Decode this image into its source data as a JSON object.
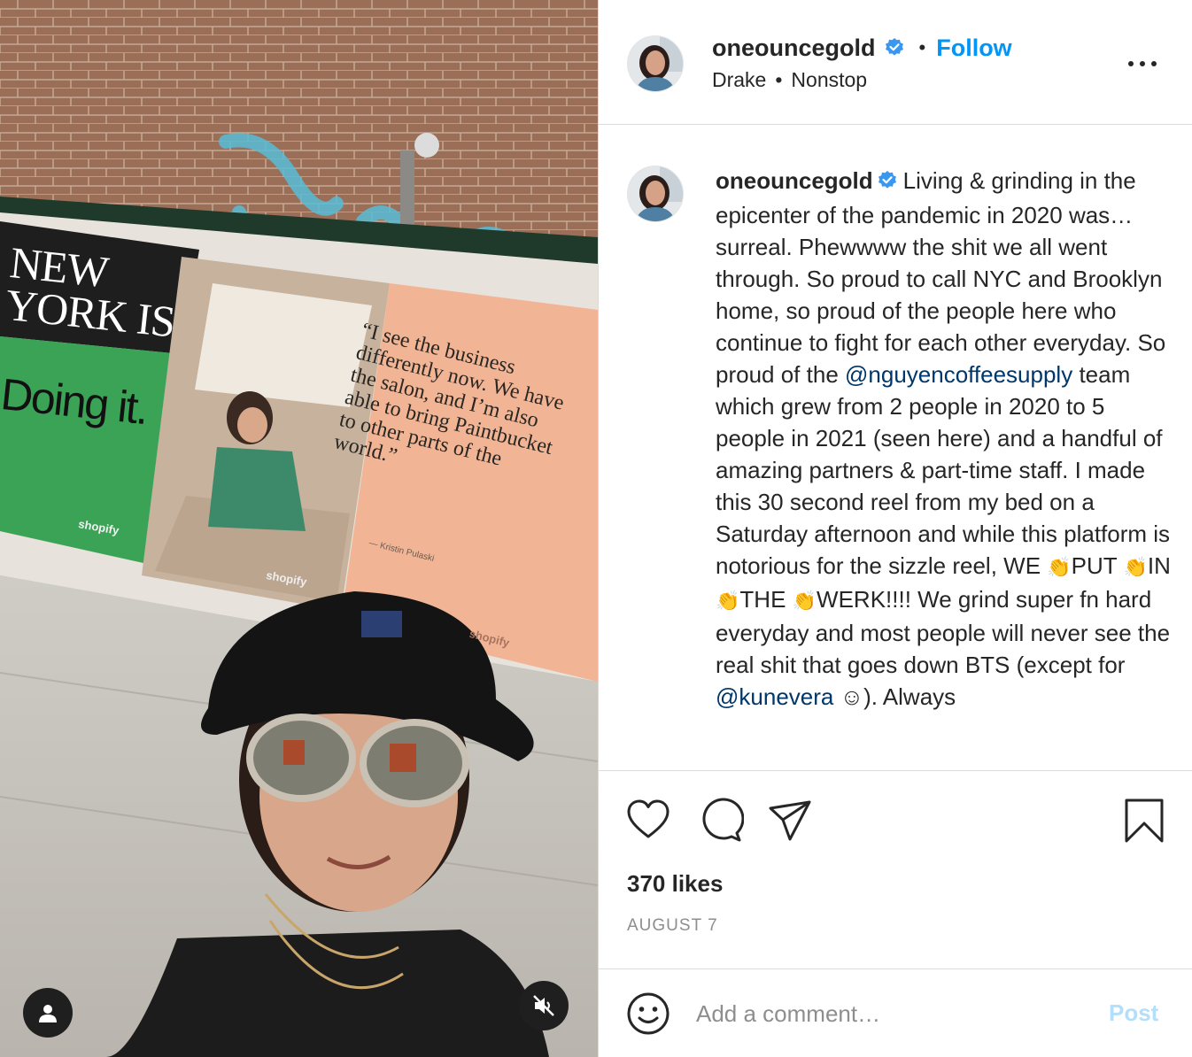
{
  "media": {
    "ad_left_text": "NEW YORK IS",
    "ad_left_text_2": "Doing it.",
    "ad_quote": "“I see the business differently now. We have the salon, and I’m also able to bring Paintbucket to other parts of the world.”",
    "ad_attribution": "— Kristin Pulaski",
    "ad_brand_1": "shopify",
    "ad_brand_2": "shopify",
    "ad_brand_3": "shopify",
    "user_button_icon": "user-icon",
    "mute_button_icon": "muted-speaker-icon"
  },
  "header": {
    "username": "oneouncegold",
    "verified_icon": "verified-badge-icon",
    "separator": "•",
    "follow_label": "Follow",
    "audio_artist": "Drake",
    "audio_separator": "•",
    "audio_track": "Nonstop",
    "more_icon": "more-options-icon"
  },
  "caption": {
    "username": "oneouncegold",
    "text_1": "Living & grinding in the epicenter of the pandemic in 2020 was… surreal. Phewwww the shit we all went through. So proud to call NYC and Brooklyn home, so proud of the people here who continue to fight for each other everyday. So proud of the ",
    "mention_1": "@nguyencoffeesupply",
    "text_2": " team which grew from 2 people in 2020 to 5 people in 2021 (seen here) and a handful of amazing partners & part-time staff. I made this 30 second reel from my bed on a Saturday afternoon and while this platform is notorious for the sizzle reel, WE ",
    "clap": "👏",
    "word_put": "PUT ",
    "word_in": "IN ",
    "word_the": "THE",
    "text_3": "WERK!!!! We grind super fn hard everyday and most people will never see the real shit that goes down BTS (except for ",
    "mention_2": "@kunevera",
    "emoji_2": "☺",
    "text_4": "). Always"
  },
  "actions": {
    "like_icon": "heart-icon",
    "comment_icon": "comment-icon",
    "share_icon": "share-icon",
    "save_icon": "bookmark-icon",
    "likes": "370 likes",
    "date": "AUGUST 7"
  },
  "comment": {
    "emoji_icon": "smiley-icon",
    "placeholder": "Add a comment…",
    "post_label": "Post"
  },
  "colors": {
    "accent": "#0095f6",
    "post_disabled": "#b2dffc",
    "mention": "#00376b",
    "muted": "#8e8e8e"
  }
}
